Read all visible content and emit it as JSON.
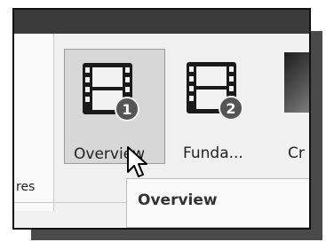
{
  "ribbon": {
    "left_panel_label": "res",
    "tiles": [
      {
        "label": "Overview",
        "badge": "1",
        "icon": "film-strip-icon",
        "selected": true
      },
      {
        "label": "Funda...",
        "badge": "2",
        "icon": "film-strip-icon",
        "selected": false
      },
      {
        "label": "Cr",
        "icon": "video-thumbnail",
        "selected": false
      }
    ]
  },
  "tooltip": {
    "text": "Overview"
  },
  "cursor": {
    "icon": "pointer-cursor-icon"
  },
  "colors": {
    "titlebar": "#3b3b3b",
    "selected_tile": "#d7d7d7",
    "badge": "#555555"
  }
}
